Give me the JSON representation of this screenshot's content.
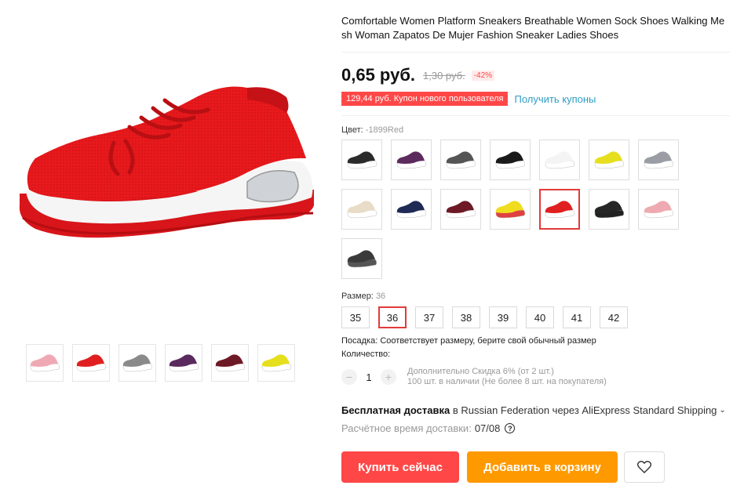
{
  "product": {
    "title": "Comfortable Women Platform Sneakers Breathable Women Sock Shoes Walking Me sh Woman Zapatos De Mujer Fashion Sneaker Ladies Shoes",
    "price": "0,65 руб.",
    "old_price": "1,30 руб.",
    "discount": "-42%",
    "coupon_text": "129,44 руб. Купон нового пользователя",
    "coupon_link": "Получить купоны"
  },
  "gallery": {
    "main_color": "#e8191c",
    "thumbnails": [
      {
        "name": "pink",
        "color": "#f0a9b4"
      },
      {
        "name": "red",
        "color": "#e02020"
      },
      {
        "name": "grey",
        "color": "#8a8a8a"
      },
      {
        "name": "purple",
        "color": "#5a2a5e"
      },
      {
        "name": "burgundy",
        "color": "#6e1a26"
      },
      {
        "name": "yellow",
        "color": "#e6df1e"
      }
    ]
  },
  "color_option": {
    "label": "Цвет:",
    "value": "-1899Red",
    "swatches": [
      {
        "color": "#2b2b2b",
        "sole": "#ffffff"
      },
      {
        "color": "#5c2b5e",
        "sole": "#ffffff"
      },
      {
        "color": "#555555",
        "sole": "#ffffff"
      },
      {
        "color": "#1a1a1a",
        "sole": "#ffffff"
      },
      {
        "color": "#f4f4f4",
        "sole": "#ffffff"
      },
      {
        "color": "#e6df1e",
        "sole": "#ffffff"
      },
      {
        "color": "#9a9ea4",
        "sole": "#ffffff"
      },
      {
        "color": "#e8dcc6",
        "sole": "#ffffff"
      },
      {
        "color": "#1f2a55",
        "sole": "#ffffff"
      },
      {
        "color": "#6e1a26",
        "sole": "#ffffff"
      },
      {
        "color": "#f0dd20",
        "sole": "#e04040"
      },
      {
        "color": "#e02020",
        "sole": "#ffffff"
      },
      {
        "color": "#262626",
        "sole": "#222222"
      },
      {
        "color": "#eeaab0",
        "sole": "#ffffff"
      },
      {
        "color": "#3a3a3a",
        "sole": "#555555"
      }
    ],
    "selected_index": 11
  },
  "size_option": {
    "label": "Размер:",
    "value": "36",
    "sizes": [
      "35",
      "36",
      "37",
      "38",
      "39",
      "40",
      "41",
      "42"
    ],
    "selected": "36"
  },
  "fit_text": "Посадка: Соответствует размеру, берите свой обычный размер",
  "quantity": {
    "label": "Количество:",
    "minus": "−",
    "value": "1",
    "plus": "+",
    "discount_info": "Дополнительно Скидка 6% (от 2 шт.)",
    "stock_info": "100 шт. в наличии (Не более 8 шт. на покупателя)"
  },
  "shipping": {
    "free": "Бесплатная доставка",
    "details": " в Russian Federation через AliExpress Standard Shipping",
    "chevron": "⌄",
    "eta_label": "Расчётное время доставки:",
    "eta_date": "07/08",
    "help": "?"
  },
  "actions": {
    "buy": "Купить сейчас",
    "cart": "Добавить в корзину",
    "wishlist_icon": "heart-icon"
  },
  "colors": {
    "accent_red": "#ff4747",
    "accent_orange": "#ff9900",
    "link_blue": "#2e9cc3"
  }
}
